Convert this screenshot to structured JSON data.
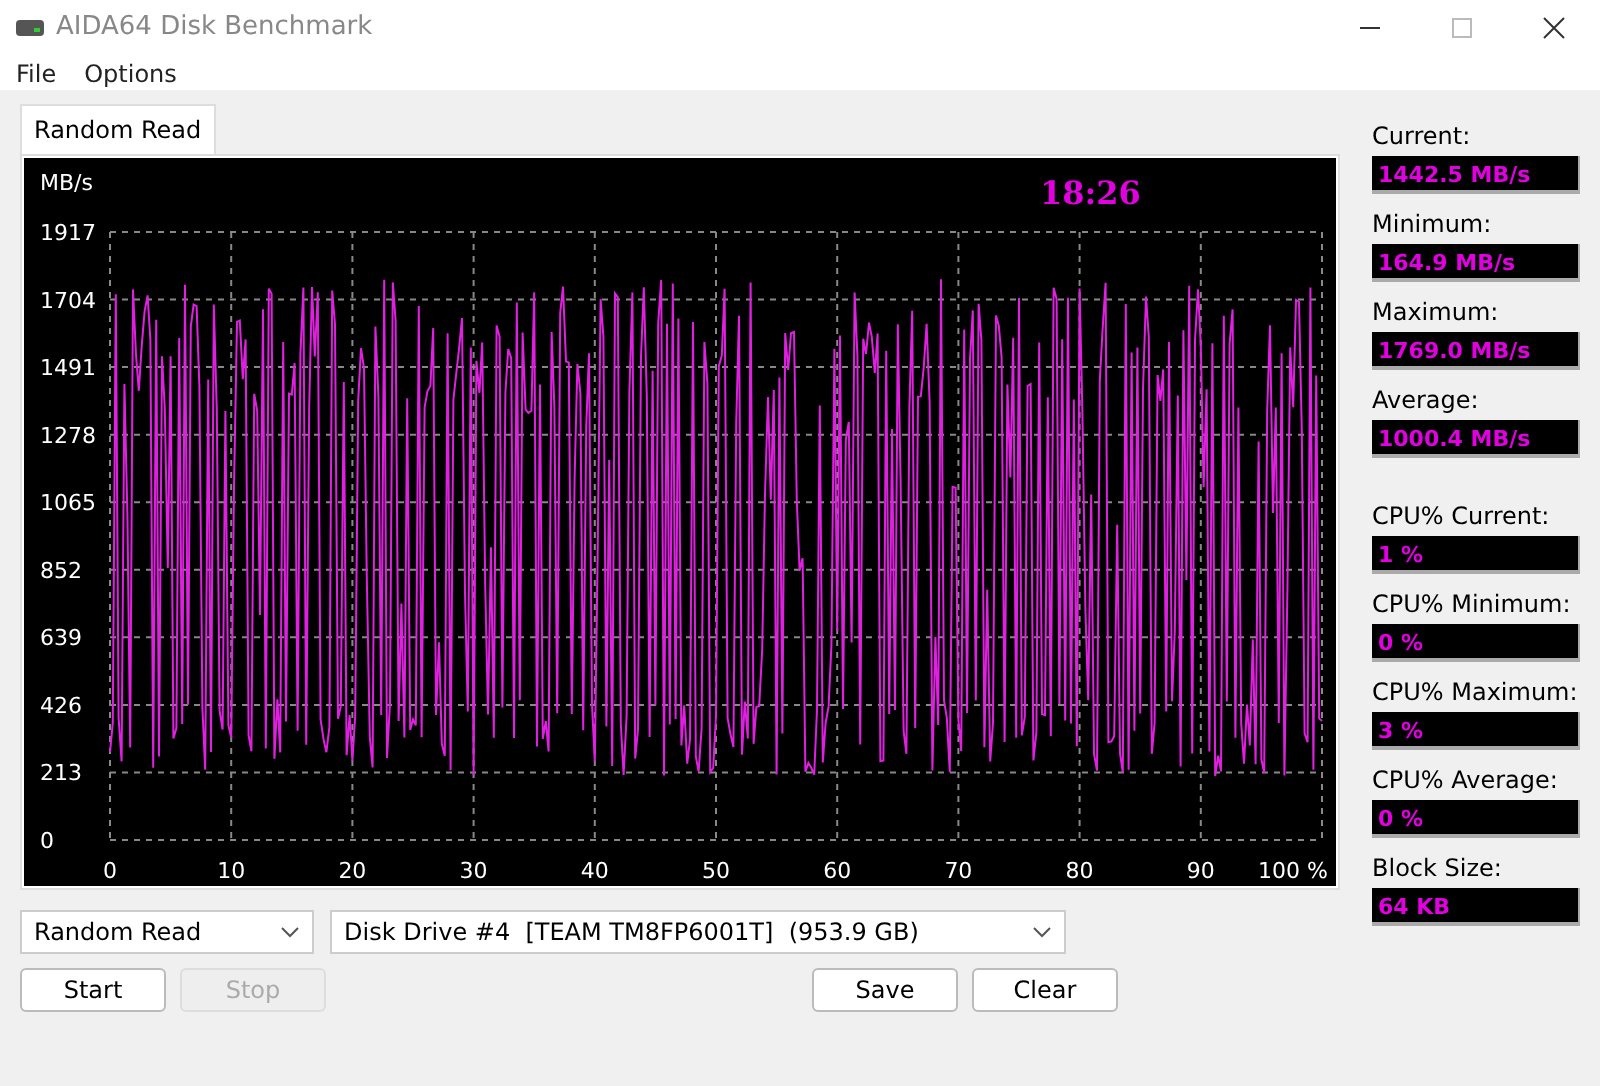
{
  "window": {
    "title": "AIDA64 Disk Benchmark"
  },
  "menu": [
    "File",
    "Options"
  ],
  "tabs": [
    {
      "label": "Random Read",
      "selected": true
    }
  ],
  "chart": {
    "unit": "MB/s",
    "time": "18:26",
    "y_labels": [
      "1917",
      "1704",
      "1491",
      "1278",
      "1065",
      "852",
      "639",
      "426",
      "213",
      "0"
    ],
    "x_labels": [
      "0",
      "10",
      "20",
      "30",
      "40",
      "50",
      "60",
      "70",
      "80",
      "90",
      "100 %"
    ]
  },
  "stats": [
    {
      "label": "Current:",
      "value": "1442.5 MB/s"
    },
    {
      "label": "Minimum:",
      "value": "164.9 MB/s"
    },
    {
      "label": "Maximum:",
      "value": "1769.0 MB/s"
    },
    {
      "label": "Average:",
      "value": "1000.4 MB/s"
    },
    {
      "label": "CPU% Current:",
      "value": "1 %"
    },
    {
      "label": "CPU% Minimum:",
      "value": "0 %"
    },
    {
      "label": "CPU% Maximum:",
      "value": "3 %"
    },
    {
      "label": "CPU% Average:",
      "value": "0 %"
    },
    {
      "label": "Block Size:",
      "value": "64 KB"
    }
  ],
  "test_select": {
    "value": "Random Read"
  },
  "drive_select": {
    "value": "Disk Drive #4  [TEAM TM8FP6001T]  (953.9 GB)"
  },
  "buttons": [
    {
      "label": "Start",
      "disabled": false
    },
    {
      "label": "Stop",
      "disabled": true
    },
    {
      "label": "Save",
      "disabled": false
    },
    {
      "label": "Clear",
      "disabled": false
    }
  ]
}
